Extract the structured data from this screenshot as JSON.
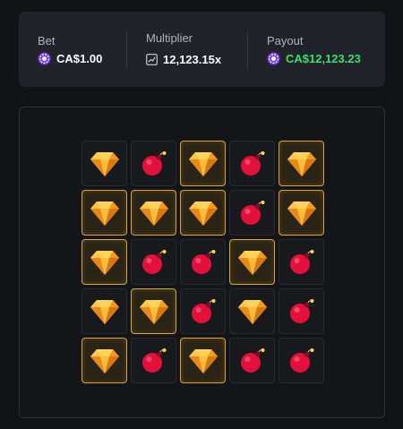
{
  "stats": {
    "bet": {
      "label": "Bet",
      "value": "CA$1.00",
      "icon": "chip-icon"
    },
    "multiplier": {
      "label": "Multiplier",
      "value": "12,123.15x",
      "icon": "multiplier-icon"
    },
    "payout": {
      "label": "Payout",
      "value": "CA$12,123.23",
      "icon": "chip-icon"
    }
  },
  "colors": {
    "accent_gold": "#d9a238",
    "payout_green": "#3ddc6e",
    "chip_purple": "#7b3cf0"
  },
  "grid": {
    "rows": [
      [
        {
          "item": "gem",
          "selected": false
        },
        {
          "item": "bomb",
          "selected": false
        },
        {
          "item": "gem",
          "selected": true
        },
        {
          "item": "bomb",
          "selected": false
        },
        {
          "item": "gem",
          "selected": true
        }
      ],
      [
        {
          "item": "gem",
          "selected": true
        },
        {
          "item": "gem",
          "selected": true
        },
        {
          "item": "gem",
          "selected": true
        },
        {
          "item": "bomb",
          "selected": false
        },
        {
          "item": "gem",
          "selected": true
        }
      ],
      [
        {
          "item": "gem",
          "selected": true
        },
        {
          "item": "bomb",
          "selected": false
        },
        {
          "item": "bomb",
          "selected": false
        },
        {
          "item": "gem",
          "selected": true
        },
        {
          "item": "bomb",
          "selected": false
        }
      ],
      [
        {
          "item": "gem",
          "selected": false
        },
        {
          "item": "gem",
          "selected": true
        },
        {
          "item": "bomb",
          "selected": false
        },
        {
          "item": "gem",
          "selected": false
        },
        {
          "item": "bomb",
          "selected": false
        }
      ],
      [
        {
          "item": "gem",
          "selected": true
        },
        {
          "item": "bomb",
          "selected": false
        },
        {
          "item": "gem",
          "selected": true
        },
        {
          "item": "bomb",
          "selected": false
        },
        {
          "item": "bomb",
          "selected": false
        }
      ]
    ]
  }
}
